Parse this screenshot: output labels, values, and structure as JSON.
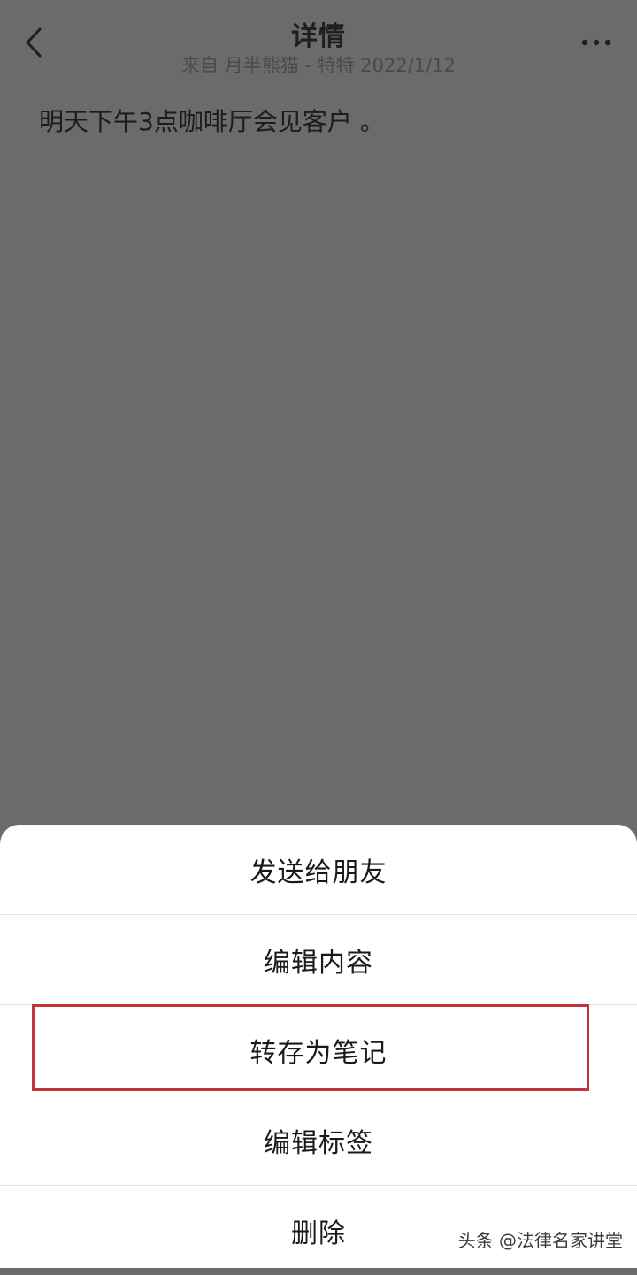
{
  "header": {
    "title": "详情",
    "subtitle": "来自 月半熊猫 - 特特 2022/1/12",
    "back_icon": "chevron-left-icon",
    "more_icon": "more-horizontal-icon"
  },
  "note": {
    "content": "明天下午3点咖啡厅会见客户 。"
  },
  "action_sheet": {
    "items": [
      {
        "label": "发送给朋友"
      },
      {
        "label": "编辑内容"
      },
      {
        "label": "转存为笔记",
        "highlighted": true
      },
      {
        "label": "编辑标签"
      },
      {
        "label": "删除"
      }
    ],
    "highlight_color": "#c4323a"
  },
  "watermark": {
    "text": "头条 @法律名家讲堂"
  }
}
